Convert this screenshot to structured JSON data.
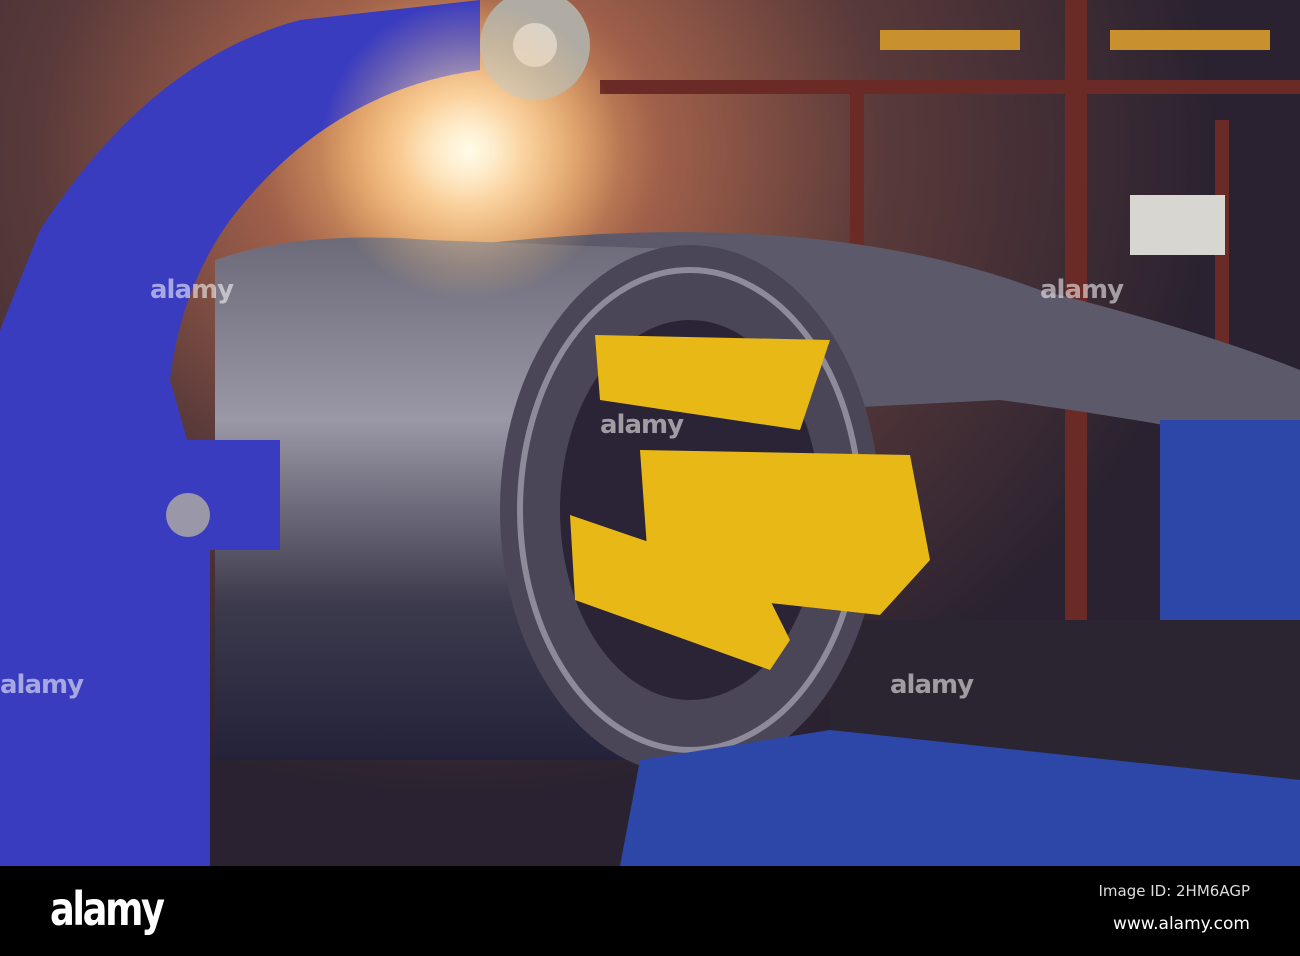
{
  "photo": {
    "subject": "steel coil on uncoiler with yellow mandrel",
    "watermark_text": "alamy"
  },
  "footer": {
    "logo": "alamy",
    "image_id": "Image ID: 2HM6AGP",
    "website": "www.alamy.com"
  }
}
